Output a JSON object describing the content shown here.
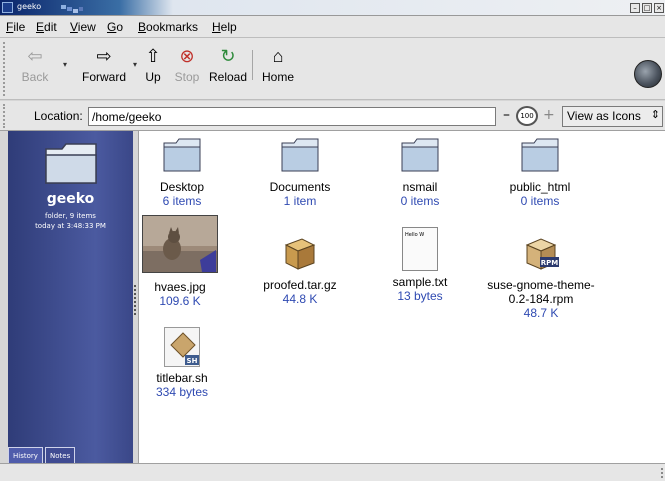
{
  "window": {
    "title": "geeko"
  },
  "menubar": {
    "items": [
      "File",
      "Edit",
      "View",
      "Go",
      "Bookmarks",
      "Help"
    ]
  },
  "toolbar": {
    "back": "Back",
    "forward": "Forward",
    "up": "Up",
    "stop": "Stop",
    "reload": "Reload",
    "home": "Home"
  },
  "location": {
    "label": "Location:",
    "value": "/home/geeko",
    "zoom": "100",
    "view_mode": "View as Icons"
  },
  "sidebar": {
    "name": "geeko",
    "info": "folder, 9 items",
    "date": "today at 3:48:33 PM",
    "tabs": [
      "History",
      "Notes"
    ]
  },
  "files": [
    {
      "name": "Desktop",
      "sub": "6 items",
      "kind": "folder"
    },
    {
      "name": "Documents",
      "sub": "1 item",
      "kind": "folder"
    },
    {
      "name": "nsmail",
      "sub": "0 items",
      "kind": "folder"
    },
    {
      "name": "public_html",
      "sub": "0 items",
      "kind": "folder"
    },
    {
      "name": "hvaes.jpg",
      "sub": "109.6 K",
      "kind": "image"
    },
    {
      "name": "proofed.tar.gz",
      "sub": "44.8 K",
      "kind": "archive"
    },
    {
      "name": "sample.txt",
      "sub": "13 bytes",
      "kind": "text",
      "preview": "Hello W"
    },
    {
      "name": "suse-gnome-theme-0.2-184.rpm",
      "line1": "suse-gnome-theme-",
      "line2": "0.2-184.rpm",
      "sub": "48.7 K",
      "kind": "rpm"
    },
    {
      "name": "titlebar.sh",
      "sub": "334 bytes",
      "kind": "script"
    }
  ],
  "colors": {
    "sidebar": "#3a4788",
    "link_blue": "#2f4ab2",
    "folder": "#b9cde3"
  }
}
